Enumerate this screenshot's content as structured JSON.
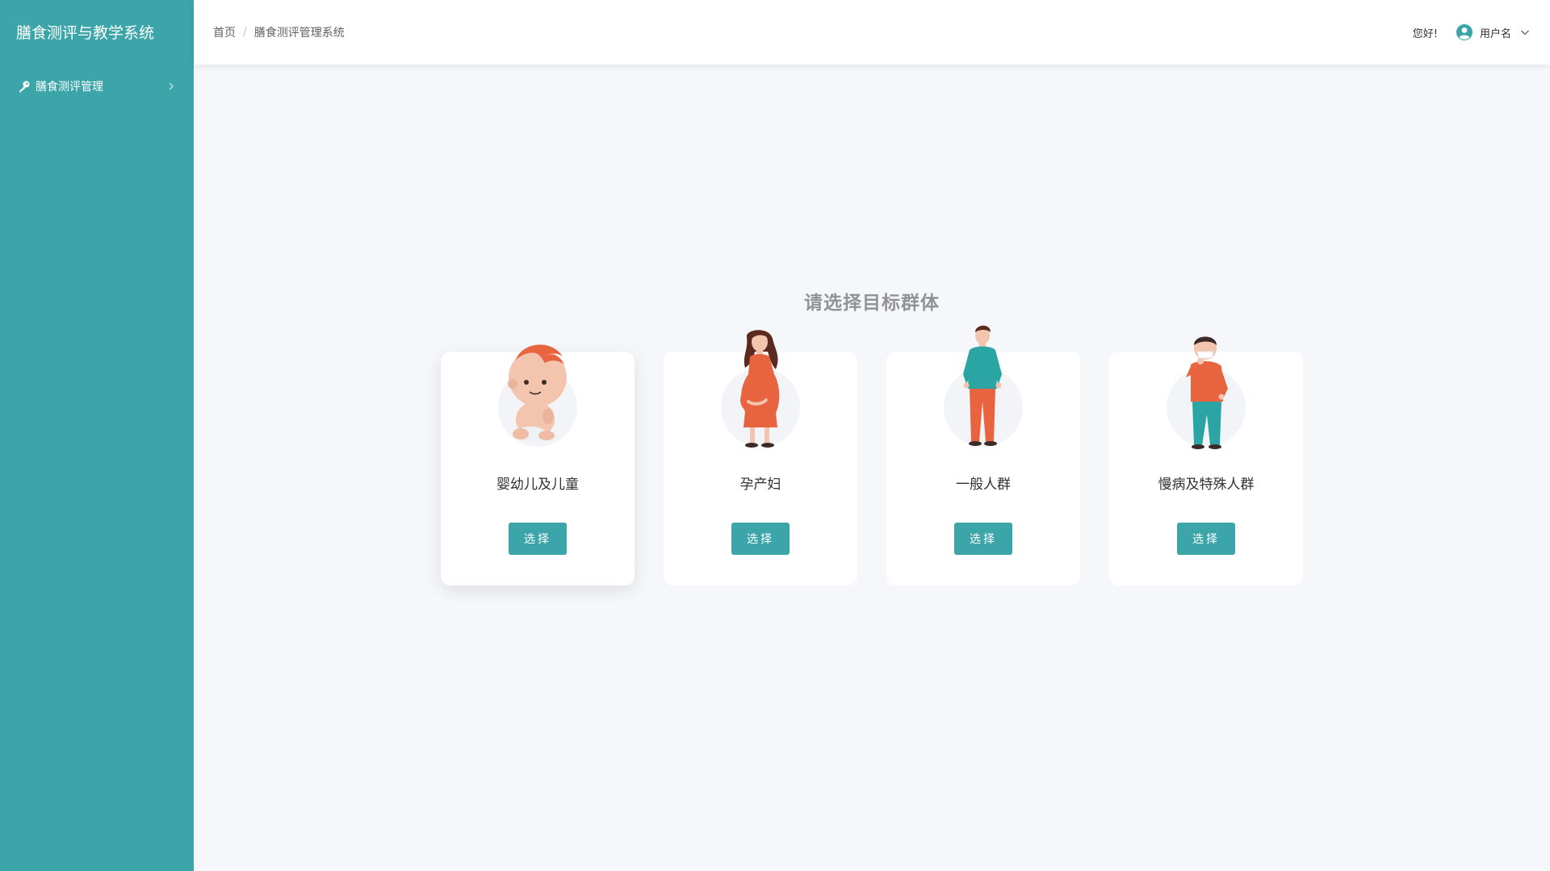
{
  "app": {
    "title": "膳食测评与教学系统"
  },
  "sidebar": {
    "items": [
      {
        "label": "膳食测评管理",
        "icon": "key-icon"
      }
    ]
  },
  "header": {
    "breadcrumb": [
      "首页",
      "膳食测评管理系统"
    ],
    "breadcrumb_sep": "/",
    "greeting": "您好!",
    "username": "用户名"
  },
  "main": {
    "title": "请选择目标群体",
    "select_label": "选择",
    "groups": [
      {
        "label": "婴幼儿及儿童",
        "icon": "baby-icon"
      },
      {
        "label": "孕产妇",
        "icon": "pregnant-woman-icon"
      },
      {
        "label": "一般人群",
        "icon": "man-icon"
      },
      {
        "label": "慢病及特殊人群",
        "icon": "sick-person-icon"
      }
    ]
  },
  "colors": {
    "accent": "#3ca5aa",
    "background": "#f5f7fa",
    "title": "#909399"
  }
}
